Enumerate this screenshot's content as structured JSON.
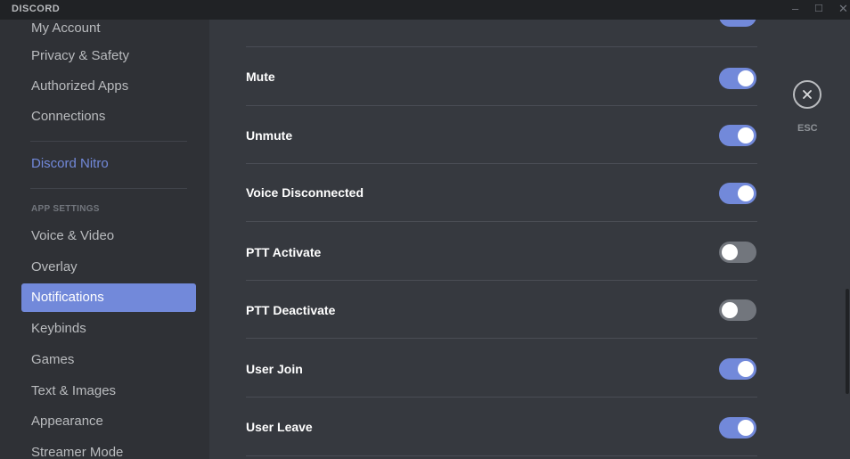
{
  "window": {
    "brand": "DISCORD",
    "minimize": "–",
    "maximize": "☐",
    "close": "✕"
  },
  "sidebar": {
    "partial_top_item": "My Account",
    "items": [
      {
        "label": "Privacy & Safety"
      },
      {
        "label": "Authorized Apps"
      },
      {
        "label": "Connections"
      }
    ],
    "nitro": "Discord Nitro",
    "app_settings_header": "APP SETTINGS",
    "app_items": [
      {
        "label": "Voice & Video"
      },
      {
        "label": "Overlay"
      },
      {
        "label": "Notifications"
      },
      {
        "label": "Keybinds"
      },
      {
        "label": "Games"
      },
      {
        "label": "Text & Images"
      },
      {
        "label": "Appearance"
      },
      {
        "label": "Streamer Mode"
      }
    ],
    "selected": "Notifications"
  },
  "sounds": [
    {
      "label": "Mute",
      "enabled": true
    },
    {
      "label": "Unmute",
      "enabled": true
    },
    {
      "label": "Voice Disconnected",
      "enabled": true
    },
    {
      "label": "PTT Activate",
      "enabled": false
    },
    {
      "label": "PTT Deactivate",
      "enabled": false
    },
    {
      "label": "User Join",
      "enabled": true
    },
    {
      "label": "User Leave",
      "enabled": true
    }
  ],
  "close": {
    "label": "ESC",
    "icon": "close-icon"
  },
  "colors": {
    "accent": "#7289da",
    "sidebar_bg": "#2f3136",
    "content_bg": "#36393f",
    "titlebar_bg": "#202225",
    "toggle_off": "#72767d"
  }
}
